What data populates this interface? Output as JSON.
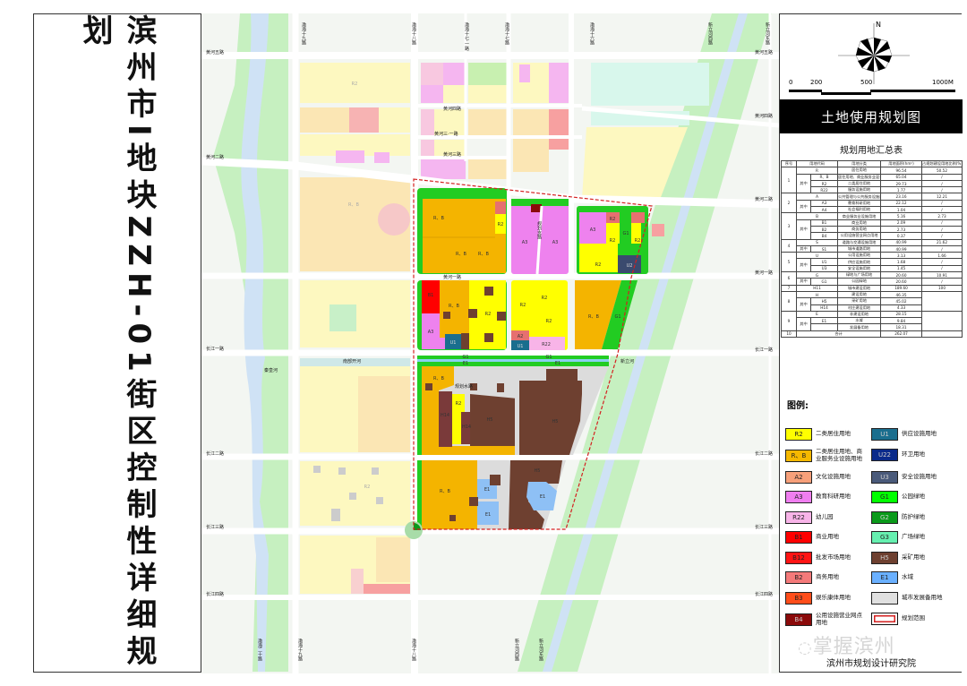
{
  "title": "滨州市I地块ZZH-01街区控制性详细规划",
  "panel": {
    "north": "N",
    "scale": [
      "0",
      "200",
      "500",
      "1000M"
    ],
    "map_title": "土地使用规划图",
    "table_title": "规划用地汇总表"
  },
  "table": {
    "headers": [
      "序号",
      "用地代码",
      "用地分类",
      "用地面积(hm²)",
      "占规划建设用地比例(%)"
    ],
    "sub_label": "其中",
    "groups": [
      {
        "no": "1",
        "code": "R",
        "name": "居住用地",
        "area": "96.54",
        "ratio": "50.52",
        "sub": [
          {
            "code": "R、B",
            "name": "居住用地、商业服务业混合",
            "area": "65.04",
            "ratio": "/"
          },
          {
            "code": "R2",
            "name": "二类居住用地",
            "area": "29.73",
            "ratio": "/"
          },
          {
            "code": "R22",
            "name": "服务设施用地",
            "area": "1.77",
            "ratio": "/"
          }
        ]
      },
      {
        "no": "2",
        "code": "A",
        "name": "公共管理与公共服务设施用地",
        "area": "23.16",
        "ratio": "12.21",
        "sub": [
          {
            "code": "A3",
            "name": "教育科研用地",
            "area": "22.12",
            "ratio": "/"
          },
          {
            "code": "A4",
            "name": "社会福利用地",
            "area": "1.04",
            "ratio": "/"
          }
        ]
      },
      {
        "no": "3",
        "code": "B",
        "name": "商业服务业设施用地",
        "area": "5.16",
        "ratio": "2.73",
        "sub": [
          {
            "code": "B1",
            "name": "商业用地",
            "area": "2.09",
            "ratio": "/"
          },
          {
            "code": "B2",
            "name": "商务用地",
            "area": "2.73",
            "ratio": "/"
          },
          {
            "code": "B4",
            "name": "公用设施营业网点用地",
            "area": "0.37",
            "ratio": "/"
          }
        ]
      },
      {
        "no": "4",
        "code": "S",
        "name": "道路与交通设施用地",
        "area": "40.99",
        "ratio": "21.62",
        "sub": [
          {
            "code": "S1",
            "name": "城市道路用地",
            "area": "40.99",
            "ratio": "/"
          }
        ]
      },
      {
        "no": "5",
        "code": "U",
        "name": "公用设施用地",
        "area": "3.13",
        "ratio": "1.66",
        "sub": [
          {
            "code": "U1",
            "name": "供应设施用地",
            "area": "1.68",
            "ratio": "/"
          },
          {
            "code": "U3",
            "name": "安全设施用地",
            "area": "1.45",
            "ratio": "/"
          }
        ]
      },
      {
        "no": "6",
        "code": "G",
        "name": "绿地与广场用地",
        "area": "20.60",
        "ratio": "10.91",
        "sub": [
          {
            "code": "G1",
            "name": "公园绿地",
            "area": "20.60",
            "ratio": "/"
          }
        ]
      },
      {
        "no": "7",
        "code": "H11",
        "name": "城市建设用地",
        "area": "189.60",
        "ratio": "100",
        "sub": []
      },
      {
        "no": "8",
        "code": "H",
        "name": "建设用地",
        "area": "46.35",
        "ratio": "",
        "sub": [
          {
            "code": "H5",
            "name": "采矿用地",
            "area": "45.02",
            "ratio": ""
          },
          {
            "code": "H14",
            "name": "村庄建设用地",
            "area": "4.33",
            "ratio": ""
          }
        ]
      },
      {
        "no": "9",
        "code": "E",
        "name": "非建设用地",
        "area": "28.15",
        "ratio": "",
        "sub": [
          {
            "code": "E1",
            "name": "水域",
            "area": "9.84",
            "ratio": ""
          },
          {
            "code": "",
            "name": "发展备用地",
            "area": "18.31",
            "ratio": ""
          }
        ]
      },
      {
        "no": "10",
        "code": "",
        "name": "合计",
        "area": "262.07",
        "ratio": "",
        "sub": []
      }
    ]
  },
  "legend": {
    "title": "图例:",
    "items": [
      {
        "code": "R2",
        "label": "二类居住用地",
        "color": "#ffff00"
      },
      {
        "code": "R、B",
        "label": "二类居住用地、商业服务业设施用地",
        "color": "#f5b800"
      },
      {
        "code": "A2",
        "label": "文化设施用地",
        "color": "#f7a07a"
      },
      {
        "code": "A3",
        "label": "教育科研用地",
        "color": "#f07ef0"
      },
      {
        "code": "R22",
        "label": "幼儿园",
        "color": "#f8b4e8"
      },
      {
        "code": "B1",
        "label": "商业用地",
        "color": "#ff0000"
      },
      {
        "code": "B12",
        "label": "批发市场用地",
        "color": "#ff1414"
      },
      {
        "code": "B2",
        "label": "商务用地",
        "color": "#f47a7a"
      },
      {
        "code": "B3",
        "label": "娱乐康体用地",
        "color": "#ff4d1a"
      },
      {
        "code": "B4",
        "label": "公用设施营业网点用地",
        "color": "#8b0a0a"
      },
      {
        "code": "U1",
        "label": "供应设施用地",
        "color": "#1a6e8e"
      },
      {
        "code": "U22",
        "label": "环卫用地",
        "color": "#0a2a8a"
      },
      {
        "code": "U3",
        "label": "安全设施用地",
        "color": "#4a5a7a"
      },
      {
        "code": "G1",
        "label": "公园绿地",
        "color": "#00ff00"
      },
      {
        "code": "G2",
        "label": "防护绿地",
        "color": "#0a9a1a"
      },
      {
        "code": "G3",
        "label": "广场绿地",
        "color": "#66f0b0"
      },
      {
        "code": "H5",
        "label": "采矿用地",
        "color": "#6e4030"
      },
      {
        "code": "E1",
        "label": "水域",
        "color": "#6ab0ff"
      },
      {
        "code": "",
        "label": "城市发展备用地",
        "color": "#e0e0e0"
      },
      {
        "code": "",
        "label": "规划范围",
        "color": "#ffffff"
      }
    ]
  },
  "watermark": "掌握滨州",
  "institute": "滨州市规划设计研究院",
  "map": {
    "roads": [
      "黄河五路",
      "黄河二路",
      "长江一路",
      "长江二路",
      "长江三路",
      "长江四路",
      "黄河五路",
      "黄河四路",
      "黄河二路",
      "黄河一路",
      "长江一路",
      "长江二路",
      "长江三路",
      "长江四路",
      "渤海十九路",
      "渤海十八路",
      "渤海十七·一路",
      "渤海十七路",
      "渤海十六路",
      "新立河西路",
      "新立河东路",
      "渤海二十路",
      "渤海十九路",
      "渤海十八路",
      "新立河西路",
      "新立河东路",
      "黄河四路",
      "黄河三·一路",
      "黄河三路",
      "黄河一路",
      "规划支路",
      "规划水路"
    ],
    "water": [
      "秦皇河",
      "南部开河",
      "新立河"
    ],
    "blocks": [
      "R、B",
      "R、B",
      "R、B",
      "R2",
      "A3",
      "A3",
      "A3",
      "R2",
      "R2",
      "R2",
      "R2",
      "U2",
      "G1",
      "B1",
      "A3",
      "R、B",
      "R2",
      "U1",
      "R2",
      "R2",
      "R2",
      "A2",
      "U1",
      "R22",
      "R、B",
      "G1",
      "G1",
      "E1",
      "G1",
      "E1",
      "R、B",
      "H14",
      "R2",
      "H14",
      "H5",
      "H5",
      "R、B",
      "E1",
      "E1",
      "H5",
      "E1",
      "R、B",
      "R2",
      "R2"
    ]
  }
}
